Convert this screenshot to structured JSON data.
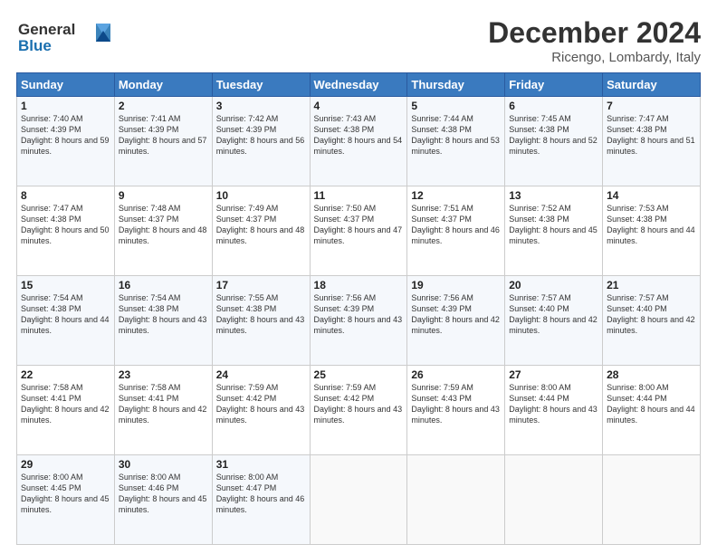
{
  "header": {
    "logo_line1": "General",
    "logo_line2": "Blue",
    "month_title": "December 2024",
    "location": "Ricengo, Lombardy, Italy"
  },
  "days_of_week": [
    "Sunday",
    "Monday",
    "Tuesday",
    "Wednesday",
    "Thursday",
    "Friday",
    "Saturday"
  ],
  "weeks": [
    [
      {
        "num": "1",
        "sunrise": "7:40 AM",
        "sunset": "4:39 PM",
        "daylight": "8 hours and 59 minutes."
      },
      {
        "num": "2",
        "sunrise": "7:41 AM",
        "sunset": "4:39 PM",
        "daylight": "8 hours and 57 minutes."
      },
      {
        "num": "3",
        "sunrise": "7:42 AM",
        "sunset": "4:39 PM",
        "daylight": "8 hours and 56 minutes."
      },
      {
        "num": "4",
        "sunrise": "7:43 AM",
        "sunset": "4:38 PM",
        "daylight": "8 hours and 54 minutes."
      },
      {
        "num": "5",
        "sunrise": "7:44 AM",
        "sunset": "4:38 PM",
        "daylight": "8 hours and 53 minutes."
      },
      {
        "num": "6",
        "sunrise": "7:45 AM",
        "sunset": "4:38 PM",
        "daylight": "8 hours and 52 minutes."
      },
      {
        "num": "7",
        "sunrise": "7:47 AM",
        "sunset": "4:38 PM",
        "daylight": "8 hours and 51 minutes."
      }
    ],
    [
      {
        "num": "8",
        "sunrise": "7:47 AM",
        "sunset": "4:38 PM",
        "daylight": "8 hours and 50 minutes."
      },
      {
        "num": "9",
        "sunrise": "7:48 AM",
        "sunset": "4:37 PM",
        "daylight": "8 hours and 48 minutes."
      },
      {
        "num": "10",
        "sunrise": "7:49 AM",
        "sunset": "4:37 PM",
        "daylight": "8 hours and 48 minutes."
      },
      {
        "num": "11",
        "sunrise": "7:50 AM",
        "sunset": "4:37 PM",
        "daylight": "8 hours and 47 minutes."
      },
      {
        "num": "12",
        "sunrise": "7:51 AM",
        "sunset": "4:37 PM",
        "daylight": "8 hours and 46 minutes."
      },
      {
        "num": "13",
        "sunrise": "7:52 AM",
        "sunset": "4:38 PM",
        "daylight": "8 hours and 45 minutes."
      },
      {
        "num": "14",
        "sunrise": "7:53 AM",
        "sunset": "4:38 PM",
        "daylight": "8 hours and 44 minutes."
      }
    ],
    [
      {
        "num": "15",
        "sunrise": "7:54 AM",
        "sunset": "4:38 PM",
        "daylight": "8 hours and 44 minutes."
      },
      {
        "num": "16",
        "sunrise": "7:54 AM",
        "sunset": "4:38 PM",
        "daylight": "8 hours and 43 minutes."
      },
      {
        "num": "17",
        "sunrise": "7:55 AM",
        "sunset": "4:38 PM",
        "daylight": "8 hours and 43 minutes."
      },
      {
        "num": "18",
        "sunrise": "7:56 AM",
        "sunset": "4:39 PM",
        "daylight": "8 hours and 43 minutes."
      },
      {
        "num": "19",
        "sunrise": "7:56 AM",
        "sunset": "4:39 PM",
        "daylight": "8 hours and 42 minutes."
      },
      {
        "num": "20",
        "sunrise": "7:57 AM",
        "sunset": "4:40 PM",
        "daylight": "8 hours and 42 minutes."
      },
      {
        "num": "21",
        "sunrise": "7:57 AM",
        "sunset": "4:40 PM",
        "daylight": "8 hours and 42 minutes."
      }
    ],
    [
      {
        "num": "22",
        "sunrise": "7:58 AM",
        "sunset": "4:41 PM",
        "daylight": "8 hours and 42 minutes."
      },
      {
        "num": "23",
        "sunrise": "7:58 AM",
        "sunset": "4:41 PM",
        "daylight": "8 hours and 42 minutes."
      },
      {
        "num": "24",
        "sunrise": "7:59 AM",
        "sunset": "4:42 PM",
        "daylight": "8 hours and 43 minutes."
      },
      {
        "num": "25",
        "sunrise": "7:59 AM",
        "sunset": "4:42 PM",
        "daylight": "8 hours and 43 minutes."
      },
      {
        "num": "26",
        "sunrise": "7:59 AM",
        "sunset": "4:43 PM",
        "daylight": "8 hours and 43 minutes."
      },
      {
        "num": "27",
        "sunrise": "8:00 AM",
        "sunset": "4:44 PM",
        "daylight": "8 hours and 43 minutes."
      },
      {
        "num": "28",
        "sunrise": "8:00 AM",
        "sunset": "4:44 PM",
        "daylight": "8 hours and 44 minutes."
      }
    ],
    [
      {
        "num": "29",
        "sunrise": "8:00 AM",
        "sunset": "4:45 PM",
        "daylight": "8 hours and 45 minutes."
      },
      {
        "num": "30",
        "sunrise": "8:00 AM",
        "sunset": "4:46 PM",
        "daylight": "8 hours and 45 minutes."
      },
      {
        "num": "31",
        "sunrise": "8:00 AM",
        "sunset": "4:47 PM",
        "daylight": "8 hours and 46 minutes."
      },
      null,
      null,
      null,
      null
    ]
  ],
  "labels": {
    "sunrise": "Sunrise:",
    "sunset": "Sunset:",
    "daylight": "Daylight:"
  }
}
